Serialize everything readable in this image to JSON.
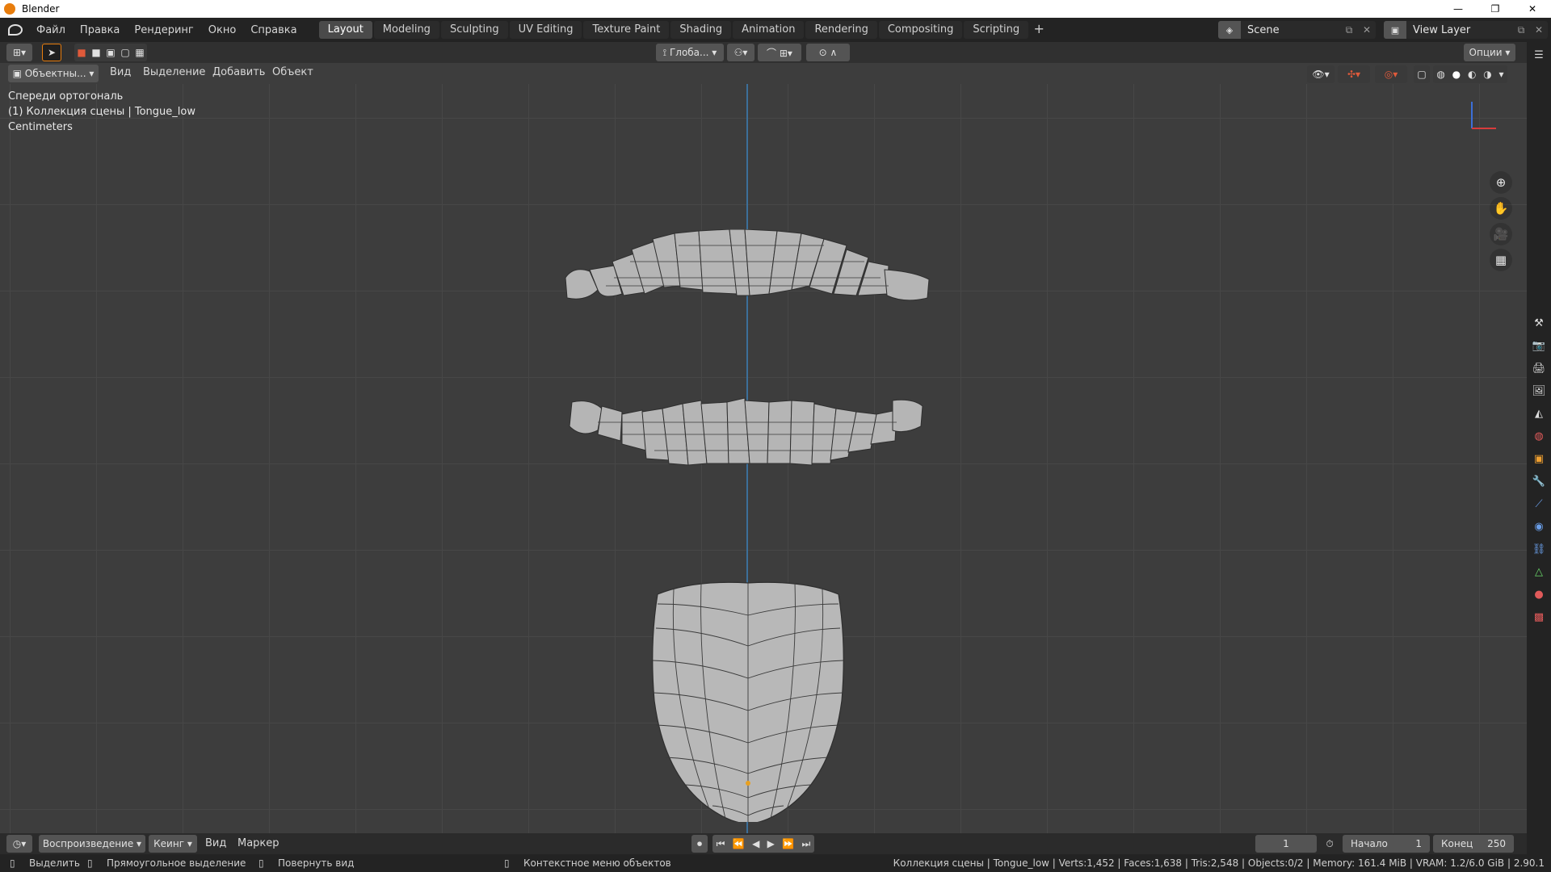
{
  "window": {
    "title": "Blender",
    "controls": [
      "—",
      "❐",
      "✕"
    ]
  },
  "menu": [
    "Файл",
    "Правка",
    "Рендеринг",
    "Окно",
    "Справка"
  ],
  "workspaces": [
    {
      "label": "Layout",
      "active": true
    },
    {
      "label": "Modeling"
    },
    {
      "label": "Sculpting"
    },
    {
      "label": "UV Editing"
    },
    {
      "label": "Texture Paint"
    },
    {
      "label": "Shading"
    },
    {
      "label": "Animation"
    },
    {
      "label": "Rendering"
    },
    {
      "label": "Compositing"
    },
    {
      "label": "Scripting"
    }
  ],
  "scene": {
    "label": "Scene"
  },
  "view_layer": {
    "label": "View Layer"
  },
  "tool_header": {
    "transform_orientation": "Глоба...",
    "options": "Опции"
  },
  "viewport_header": {
    "mode": "Объектны...",
    "view": "Вид",
    "select": "Выделение",
    "add": "Добавить",
    "object": "Объект"
  },
  "overlay": {
    "view_name": "Спереди ортогональ",
    "collection": "(1) Коллекция сцены | Tongue_low",
    "units": "Centimeters"
  },
  "timeline": {
    "playback": "Воспроизведение",
    "keying": "Кеинг",
    "view": "Вид",
    "marker": "Маркер",
    "current_frame": "1",
    "start_label": "Начало",
    "start_value": "1",
    "end_label": "Конец",
    "end_value": "250"
  },
  "statusbar": {
    "select": "Выделить",
    "box_select": "Прямоугольное выделение",
    "rotate_view": "Повернуть вид",
    "context_menu": "Контекстное меню объектов",
    "stats": "Коллекция сцены | Tongue_low | Verts:1,452 | Faces:1,638 | Tris:2,548 | Objects:0/2 | Memory: 161.4 MiB | VRAM: 1.2/6.0 GiB | 2.90.1"
  },
  "colors": {
    "accent": "#e87d0d",
    "z_axis": "#3c6f99",
    "active_tab": "#4a4a4a"
  }
}
